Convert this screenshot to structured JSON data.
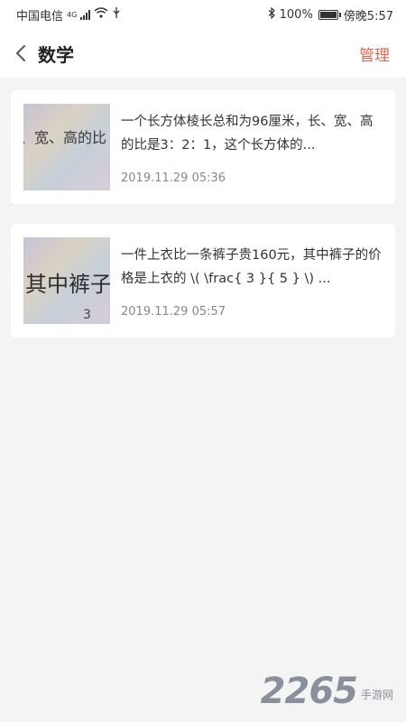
{
  "status_bar": {
    "carrier": "中国电信",
    "network": "4G",
    "battery": "100%",
    "time": "傍晚5:57"
  },
  "header": {
    "title": "数学",
    "manage_label": "管理"
  },
  "items": [
    {
      "text": "一个长方体棱长总和为96厘米，长、宽、高的比是3：2：1，这个长方体的...",
      "date": "2019.11.29 05:36",
      "thumb_text": "、宽、高的比"
    },
    {
      "text": "一件上衣比一条裤子贵160元，其中裤子的价格是上衣的 \\( \\frac{ 3 }{ 5 } \\) ...",
      "date": "2019.11.29 05:57",
      "thumb_text": "其中裤子",
      "thumb_sub": "3"
    }
  ],
  "watermark": {
    "number": "2265",
    "text": "手游网"
  }
}
